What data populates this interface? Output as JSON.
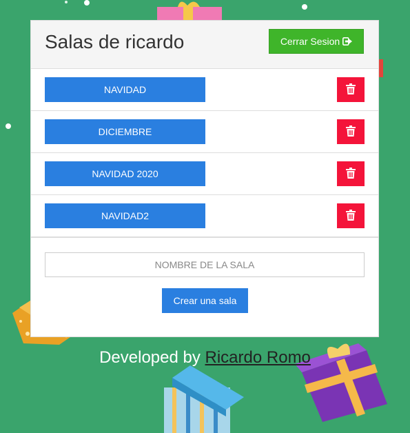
{
  "header": {
    "title": "Salas de ricardo",
    "logout_label": "Cerrar Sesion"
  },
  "rooms": [
    {
      "name": "NAVIDAD"
    },
    {
      "name": "DICIEMBRE"
    },
    {
      "name": "NAVIDAD 2020"
    },
    {
      "name": "NAVIDAD2"
    }
  ],
  "form": {
    "input_placeholder": "NOMBRE DE LA SALA",
    "input_value": "",
    "create_label": "Crear una sala"
  },
  "footer": {
    "prefix": "Developed by",
    "author": "Ricardo Romo"
  },
  "icons": {
    "logout": "sign-out-icon",
    "delete": "trash-icon"
  },
  "colors": {
    "background": "#3aa46c",
    "logout_button": "#3fb52a",
    "room_button": "#2a7fe0",
    "delete_button": "#f4143a"
  }
}
